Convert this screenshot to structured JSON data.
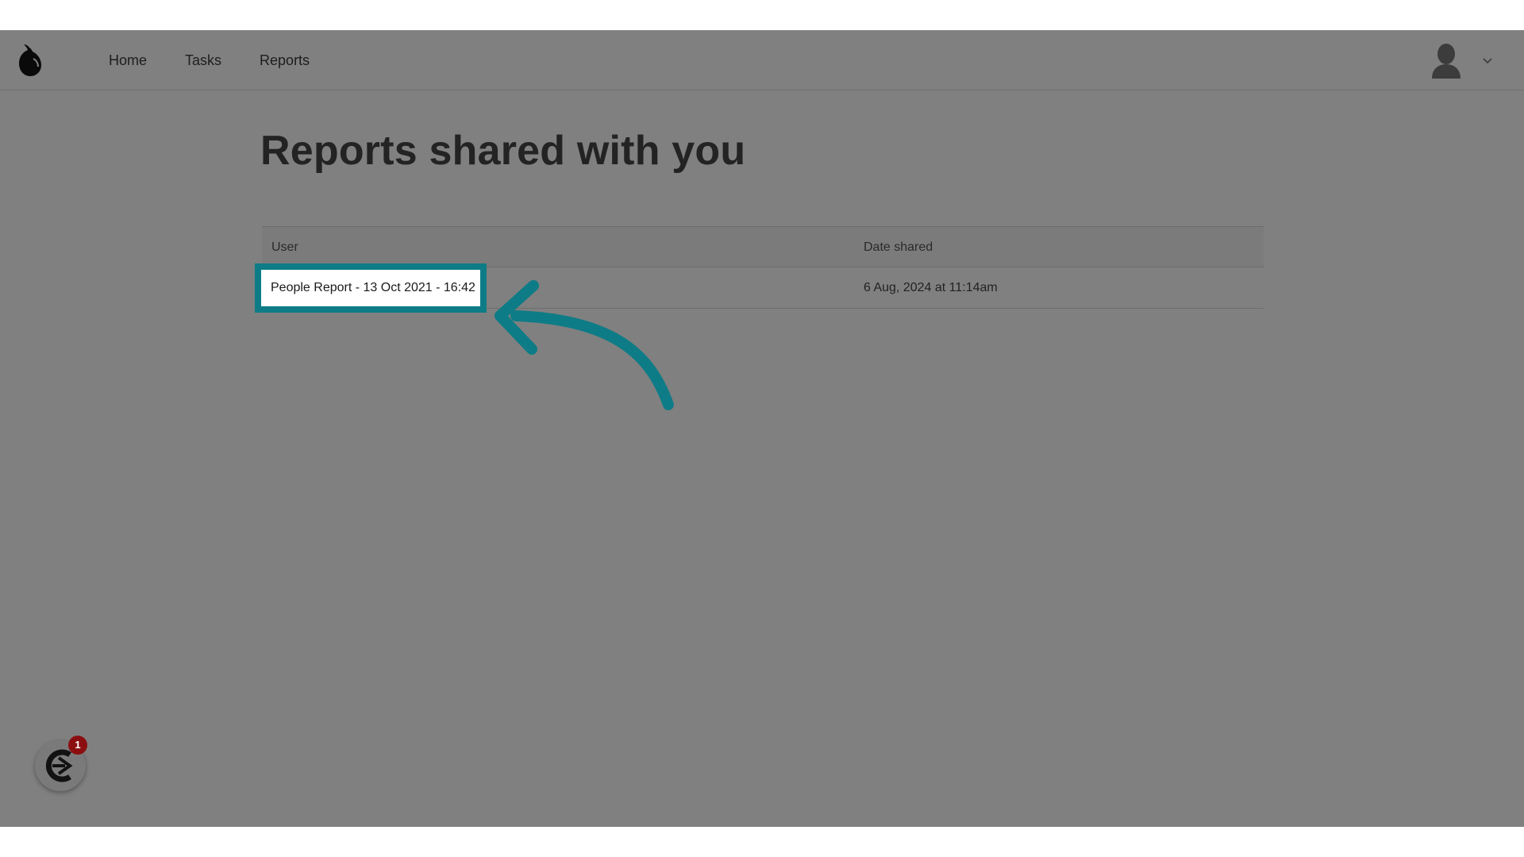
{
  "nav": {
    "items": [
      {
        "label": "Home"
      },
      {
        "label": "Tasks"
      },
      {
        "label": "Reports"
      }
    ]
  },
  "page": {
    "title": "Reports shared with you"
  },
  "table": {
    "columns": [
      "User",
      "Date shared"
    ],
    "rows": [
      {
        "user": "People Report - 13 Oct 2021 - 16:42",
        "date_shared": "6 Aug, 2024 at 11:14am"
      }
    ]
  },
  "widget": {
    "badge_count": "1"
  },
  "colors": {
    "highlight": "#0e7c86",
    "overlay": "#808080",
    "badge": "#8b0f10"
  },
  "icons": {
    "logo": "pear-logo-icon",
    "avatar": "user-avatar-icon",
    "menu": "chevron-down-icon",
    "widget": "assistant-widget-icon",
    "annotation": "curved-arrow-icon"
  }
}
